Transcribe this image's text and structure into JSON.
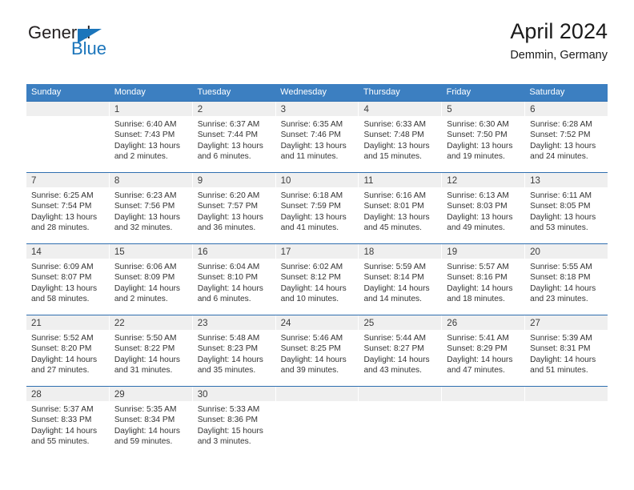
{
  "brand": {
    "logo_text_1": "General",
    "logo_text_2": "Blue",
    "triangle_icon": "triangle-icon",
    "color_accent": "#1b75bb"
  },
  "header": {
    "title": "April 2024",
    "subtitle": "Demmin, Germany"
  },
  "theme": {
    "header_row_bg": "#3c7fc1",
    "week_divider": "#2f6fb0",
    "daynum_band_bg": "#efefef",
    "text": "#333333"
  },
  "columns": [
    "Sunday",
    "Monday",
    "Tuesday",
    "Wednesday",
    "Thursday",
    "Friday",
    "Saturday"
  ],
  "calendar_data": {
    "type": "table",
    "title": "April 2024",
    "location": "Demmin, Germany",
    "weeks": [
      [
        {
          "day": "",
          "lines": []
        },
        {
          "day": "1",
          "lines": [
            "Sunrise: 6:40 AM",
            "Sunset: 7:43 PM",
            "Daylight: 13 hours",
            "and 2 minutes."
          ]
        },
        {
          "day": "2",
          "lines": [
            "Sunrise: 6:37 AM",
            "Sunset: 7:44 PM",
            "Daylight: 13 hours",
            "and 6 minutes."
          ]
        },
        {
          "day": "3",
          "lines": [
            "Sunrise: 6:35 AM",
            "Sunset: 7:46 PM",
            "Daylight: 13 hours",
            "and 11 minutes."
          ]
        },
        {
          "day": "4",
          "lines": [
            "Sunrise: 6:33 AM",
            "Sunset: 7:48 PM",
            "Daylight: 13 hours",
            "and 15 minutes."
          ]
        },
        {
          "day": "5",
          "lines": [
            "Sunrise: 6:30 AM",
            "Sunset: 7:50 PM",
            "Daylight: 13 hours",
            "and 19 minutes."
          ]
        },
        {
          "day": "6",
          "lines": [
            "Sunrise: 6:28 AM",
            "Sunset: 7:52 PM",
            "Daylight: 13 hours",
            "and 24 minutes."
          ]
        }
      ],
      [
        {
          "day": "7",
          "lines": [
            "Sunrise: 6:25 AM",
            "Sunset: 7:54 PM",
            "Daylight: 13 hours",
            "and 28 minutes."
          ]
        },
        {
          "day": "8",
          "lines": [
            "Sunrise: 6:23 AM",
            "Sunset: 7:56 PM",
            "Daylight: 13 hours",
            "and 32 minutes."
          ]
        },
        {
          "day": "9",
          "lines": [
            "Sunrise: 6:20 AM",
            "Sunset: 7:57 PM",
            "Daylight: 13 hours",
            "and 36 minutes."
          ]
        },
        {
          "day": "10",
          "lines": [
            "Sunrise: 6:18 AM",
            "Sunset: 7:59 PM",
            "Daylight: 13 hours",
            "and 41 minutes."
          ]
        },
        {
          "day": "11",
          "lines": [
            "Sunrise: 6:16 AM",
            "Sunset: 8:01 PM",
            "Daylight: 13 hours",
            "and 45 minutes."
          ]
        },
        {
          "day": "12",
          "lines": [
            "Sunrise: 6:13 AM",
            "Sunset: 8:03 PM",
            "Daylight: 13 hours",
            "and 49 minutes."
          ]
        },
        {
          "day": "13",
          "lines": [
            "Sunrise: 6:11 AM",
            "Sunset: 8:05 PM",
            "Daylight: 13 hours",
            "and 53 minutes."
          ]
        }
      ],
      [
        {
          "day": "14",
          "lines": [
            "Sunrise: 6:09 AM",
            "Sunset: 8:07 PM",
            "Daylight: 13 hours",
            "and 58 minutes."
          ]
        },
        {
          "day": "15",
          "lines": [
            "Sunrise: 6:06 AM",
            "Sunset: 8:09 PM",
            "Daylight: 14 hours",
            "and 2 minutes."
          ]
        },
        {
          "day": "16",
          "lines": [
            "Sunrise: 6:04 AM",
            "Sunset: 8:10 PM",
            "Daylight: 14 hours",
            "and 6 minutes."
          ]
        },
        {
          "day": "17",
          "lines": [
            "Sunrise: 6:02 AM",
            "Sunset: 8:12 PM",
            "Daylight: 14 hours",
            "and 10 minutes."
          ]
        },
        {
          "day": "18",
          "lines": [
            "Sunrise: 5:59 AM",
            "Sunset: 8:14 PM",
            "Daylight: 14 hours",
            "and 14 minutes."
          ]
        },
        {
          "day": "19",
          "lines": [
            "Sunrise: 5:57 AM",
            "Sunset: 8:16 PM",
            "Daylight: 14 hours",
            "and 18 minutes."
          ]
        },
        {
          "day": "20",
          "lines": [
            "Sunrise: 5:55 AM",
            "Sunset: 8:18 PM",
            "Daylight: 14 hours",
            "and 23 minutes."
          ]
        }
      ],
      [
        {
          "day": "21",
          "lines": [
            "Sunrise: 5:52 AM",
            "Sunset: 8:20 PM",
            "Daylight: 14 hours",
            "and 27 minutes."
          ]
        },
        {
          "day": "22",
          "lines": [
            "Sunrise: 5:50 AM",
            "Sunset: 8:22 PM",
            "Daylight: 14 hours",
            "and 31 minutes."
          ]
        },
        {
          "day": "23",
          "lines": [
            "Sunrise: 5:48 AM",
            "Sunset: 8:23 PM",
            "Daylight: 14 hours",
            "and 35 minutes."
          ]
        },
        {
          "day": "24",
          "lines": [
            "Sunrise: 5:46 AM",
            "Sunset: 8:25 PM",
            "Daylight: 14 hours",
            "and 39 minutes."
          ]
        },
        {
          "day": "25",
          "lines": [
            "Sunrise: 5:44 AM",
            "Sunset: 8:27 PM",
            "Daylight: 14 hours",
            "and 43 minutes."
          ]
        },
        {
          "day": "26",
          "lines": [
            "Sunrise: 5:41 AM",
            "Sunset: 8:29 PM",
            "Daylight: 14 hours",
            "and 47 minutes."
          ]
        },
        {
          "day": "27",
          "lines": [
            "Sunrise: 5:39 AM",
            "Sunset: 8:31 PM",
            "Daylight: 14 hours",
            "and 51 minutes."
          ]
        }
      ],
      [
        {
          "day": "28",
          "lines": [
            "Sunrise: 5:37 AM",
            "Sunset: 8:33 PM",
            "Daylight: 14 hours",
            "and 55 minutes."
          ]
        },
        {
          "day": "29",
          "lines": [
            "Sunrise: 5:35 AM",
            "Sunset: 8:34 PM",
            "Daylight: 14 hours",
            "and 59 minutes."
          ]
        },
        {
          "day": "30",
          "lines": [
            "Sunrise: 5:33 AM",
            "Sunset: 8:36 PM",
            "Daylight: 15 hours",
            "and 3 minutes."
          ]
        },
        {
          "day": "",
          "lines": []
        },
        {
          "day": "",
          "lines": []
        },
        {
          "day": "",
          "lines": []
        },
        {
          "day": "",
          "lines": []
        }
      ]
    ]
  }
}
